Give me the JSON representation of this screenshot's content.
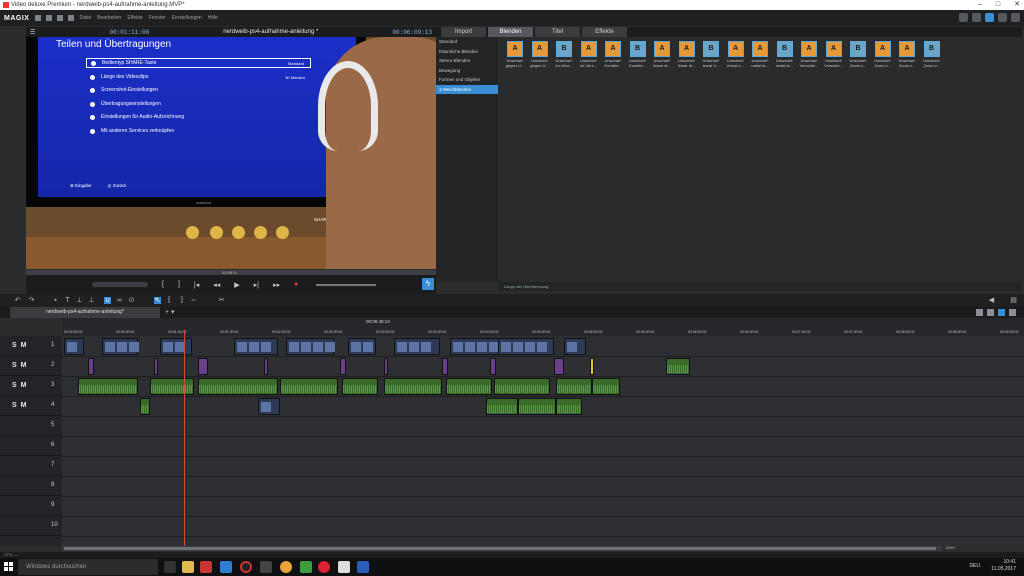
{
  "window": {
    "title": "Video deluxe Premium - nerdweib-ps4-aufnahme-anleitung.MVP*"
  },
  "menu": {
    "logo": "MAGIX",
    "items": [
      "Datei",
      "Bearbeiten",
      "Effekte",
      "Fenster",
      "Einstellungen",
      "Hilfe"
    ]
  },
  "preview": {
    "timecode_left": "00:01:11:08",
    "title": "nerdweib-ps4-aufnahme-anleitung *",
    "timecode_right": "00:06:09:13",
    "screen_title": "Teilen und Übertragungen",
    "options": [
      {
        "label": "Bedientyp SHARE-Taste",
        "value": "Standard"
      },
      {
        "label": "Länge des Videoclips",
        "value": "30 Minuten"
      },
      {
        "label": "Screenshot-Einstellungen",
        "value": ""
      },
      {
        "label": "Übertragungseinstellungen",
        "value": ""
      },
      {
        "label": "Einstellungen für Audio-Aufzeichnung",
        "value": ""
      },
      {
        "label": "Mit anderen Services verknüpfen",
        "value": ""
      }
    ],
    "hint_enter": "⊗ Eingabe",
    "hint_back": "◎ Zurück",
    "share_hint": "SHARE Anzeigen",
    "tv_brand": "SAMSUNG",
    "transport_tc": "00:08:11"
  },
  "pool": {
    "tabs": [
      "Import",
      "Blenden",
      "Titel",
      "Effekte"
    ],
    "active_tab": 1,
    "categories": [
      "Standard",
      "Räumliche Blenden",
      "Stereo-Blenden",
      "Bewegung",
      "Formen und Objekte",
      "3 Weichblenden"
    ],
    "active_category": 5,
    "items": [
      "Unscharf: gegen U...",
      "Unscharf: gegen U...",
      "Unscharf: im Uhrz...",
      "Unscharf: im Uhrz...",
      "Unscharf: Kombin...",
      "Unscharf: Kombin...",
      "Unscharf: linear di...",
      "Unscharf: linear di...",
      "Unscharf: linear h...",
      "Unscharf: linear-v...",
      "Unscharf: radial la...",
      "Unscharf: radial le...",
      "Unscharf: Verschie...",
      "Unscharf: Verschie...",
      "Unscharf: Zoom v...",
      "Unscharf: Zoom v...",
      "Unscharf: Zoom v...",
      "Unscharf: Zoom v..."
    ],
    "footer": "Länge der Überblendung:"
  },
  "timeline": {
    "project_tab": "nerdweib-ps4-aufnahme-anleitung*",
    "position": "00:06:49:13",
    "ticks": [
      "00:00:00:00",
      "00:00:30:00",
      "00:01:00:00",
      "00:01:30:00",
      "00:02:00:00",
      "00:02:30:00",
      "00:03:00:00",
      "00:03:30:00",
      "00:04:00:00",
      "00:04:30:00",
      "00:05:00:00",
      "00:05:30:00",
      "00:06:00:00",
      "00:06:30:00",
      "00:07:00:00",
      "00:07:30:00",
      "00:08:00:00",
      "00:08:30:00",
      "00:09:00:00"
    ],
    "tracks": [
      "1",
      "2",
      "3",
      "4",
      "5",
      "6",
      "7",
      "8",
      "9",
      "10"
    ],
    "track_controls": "S M",
    "zoom": "100%",
    "status": "CPU: —"
  },
  "taskbar": {
    "search": "Windows durchsuchen",
    "lang": "DEU",
    "time": "10:41",
    "date": "11.05.2017"
  }
}
